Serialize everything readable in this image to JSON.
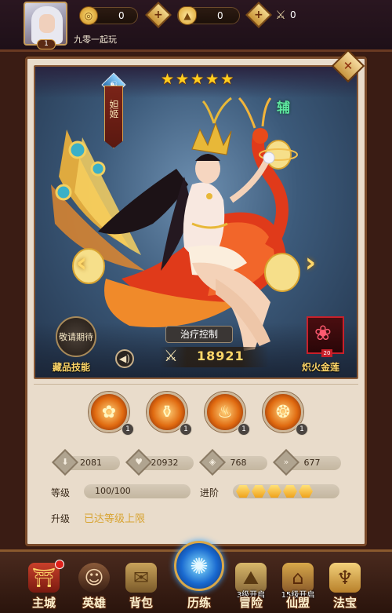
{
  "player": {
    "name": "九零一起玩",
    "level": "1"
  },
  "resources": {
    "coin": "0",
    "ingot": "0",
    "power_token": "0"
  },
  "hero": {
    "name": "妲姬",
    "role": "辅",
    "stars": 5,
    "element_glyph": "☯",
    "skill_type": "治疗控制",
    "combat_power": "18921",
    "collect_button": "敬请期待",
    "collect_label": "藏品技能",
    "treasure": {
      "name": "炽火金莲",
      "level": "20"
    }
  },
  "skills": [
    {
      "icon": "lotus-fire-icon",
      "level": "1"
    },
    {
      "icon": "ingot-fire-icon",
      "level": "1"
    },
    {
      "icon": "phoenix-icon",
      "level": "1"
    },
    {
      "icon": "phoenix-swirl-icon",
      "level": "1"
    }
  ],
  "stats": [
    {
      "icon": "attack-icon",
      "value": "2081"
    },
    {
      "icon": "health-icon",
      "value": "20932"
    },
    {
      "icon": "defense-icon",
      "value": "768"
    },
    {
      "icon": "speed-icon",
      "value": "677"
    }
  ],
  "progress": {
    "level_label": "等级",
    "level_value": "100/100",
    "rank_label": "进阶",
    "rank_filled": 5,
    "upgrade_label": "升级",
    "upgrade_status": "已达等级上限"
  },
  "nav": [
    {
      "label": "主城",
      "icon": "city-gate-icon",
      "note": ""
    },
    {
      "label": "英雄",
      "icon": "hero-portrait-icon",
      "note": ""
    },
    {
      "label": "背包",
      "icon": "backpack-icon",
      "note": ""
    },
    {
      "label": "历练",
      "icon": "portal-orb-icon",
      "note": ""
    },
    {
      "label": "冒险",
      "icon": "adventure-icon",
      "note": "3级开启"
    },
    {
      "label": "仙盟",
      "icon": "alliance-icon",
      "note": "15级开启"
    },
    {
      "label": "法宝",
      "icon": "treasure-gourd-icon",
      "note": ""
    }
  ],
  "colors": {
    "gold_text": "#ffd86a",
    "role_green": "#5ee7a0",
    "upgrade_gold": "#d8a432",
    "frame_brown": "#7a4a2a"
  }
}
